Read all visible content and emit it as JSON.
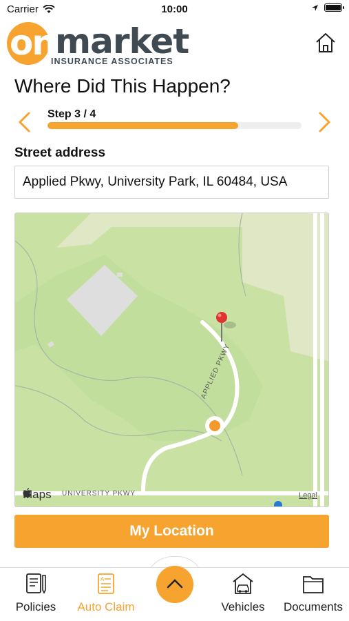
{
  "status_bar": {
    "carrier": "Carrier",
    "time": "10:00"
  },
  "header": {
    "logo_on": "on",
    "logo_market": "market",
    "logo_subtitle": "INSURANCE ASSOCIATES"
  },
  "page": {
    "title": "Where Did This Happen?",
    "step_label": "Step 3 / 4",
    "progress_fraction": 0.75
  },
  "address": {
    "label": "Street address",
    "value": "Applied Pkwy, University Park, IL 60484, USA"
  },
  "map": {
    "attribution": "Maps",
    "legal": "Legal",
    "road_label_1": "APPLIED PKWY",
    "road_label_2": "UNIVERSITY PKWY"
  },
  "actions": {
    "my_location_label": "My Location"
  },
  "tab_bar": {
    "tabs": [
      {
        "label": "Policies",
        "icon": "policies-icon",
        "active": false
      },
      {
        "label": "Auto Claim",
        "icon": "auto-claim-icon",
        "active": true
      },
      {
        "label": "Vehicles",
        "icon": "vehicles-icon",
        "active": false
      },
      {
        "label": "Documents",
        "icon": "documents-icon",
        "active": false
      }
    ]
  },
  "colors": {
    "accent": "#f6a330",
    "brand_dark": "#3f4a52",
    "map_park": "#c9e2a4",
    "map_land": "#dfe7c4"
  }
}
